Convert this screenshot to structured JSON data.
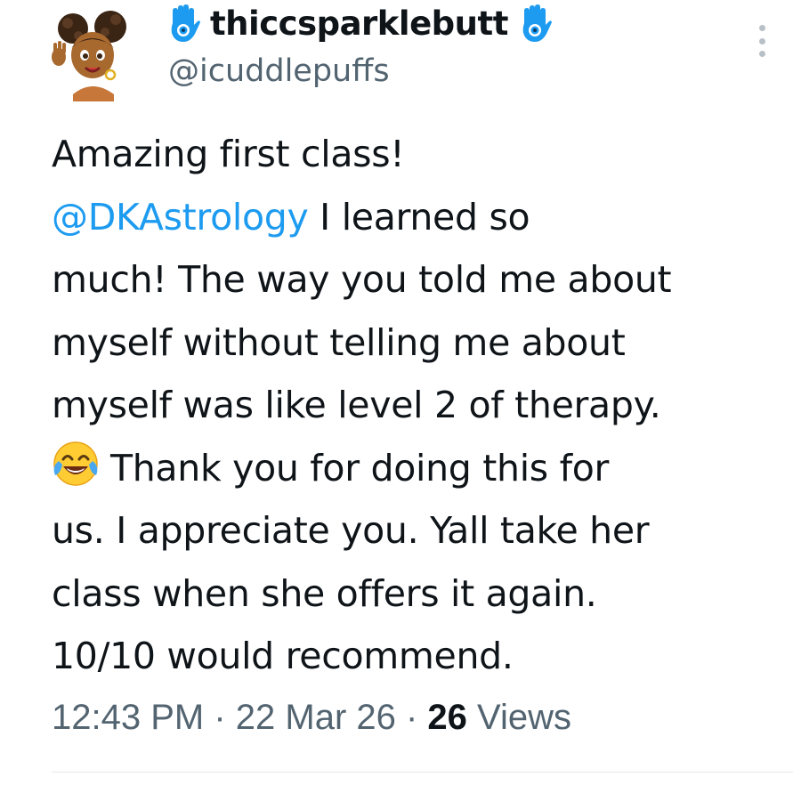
{
  "user": {
    "display_name": "thiccsparklebutt",
    "handle": "@icuddlepuffs",
    "avatar_icon": "cartoon-avatar",
    "badge_icon": "hamsa-hand-emoji"
  },
  "tweet": {
    "lines": [
      {
        "text": "Amazing first class!"
      },
      {
        "mention": "@DKAstrology",
        "text": " I learned so"
      },
      {
        "text": "much! The way you told me about"
      },
      {
        "text": "myself without telling me about"
      },
      {
        "text": "myself was like level 2 of therapy."
      },
      {
        "emoji": "face-with-tears-of-joy",
        "text": "Thank you for doing this for"
      },
      {
        "text": "us. I appreciate you. Yall take her"
      },
      {
        "text": "class when she offers it again."
      },
      {
        "text": "10/10 would recommend."
      }
    ],
    "time": "12:43 PM",
    "date": "22 Mar 26",
    "separator": " · ",
    "views_count": "26",
    "views_label": " Views"
  },
  "colors": {
    "text": "#0f1419",
    "secondary": "#536471",
    "mention": "#1d9bf0",
    "divider": "#e7e9ea"
  },
  "icons": {
    "more": "more-vertical-icon"
  }
}
